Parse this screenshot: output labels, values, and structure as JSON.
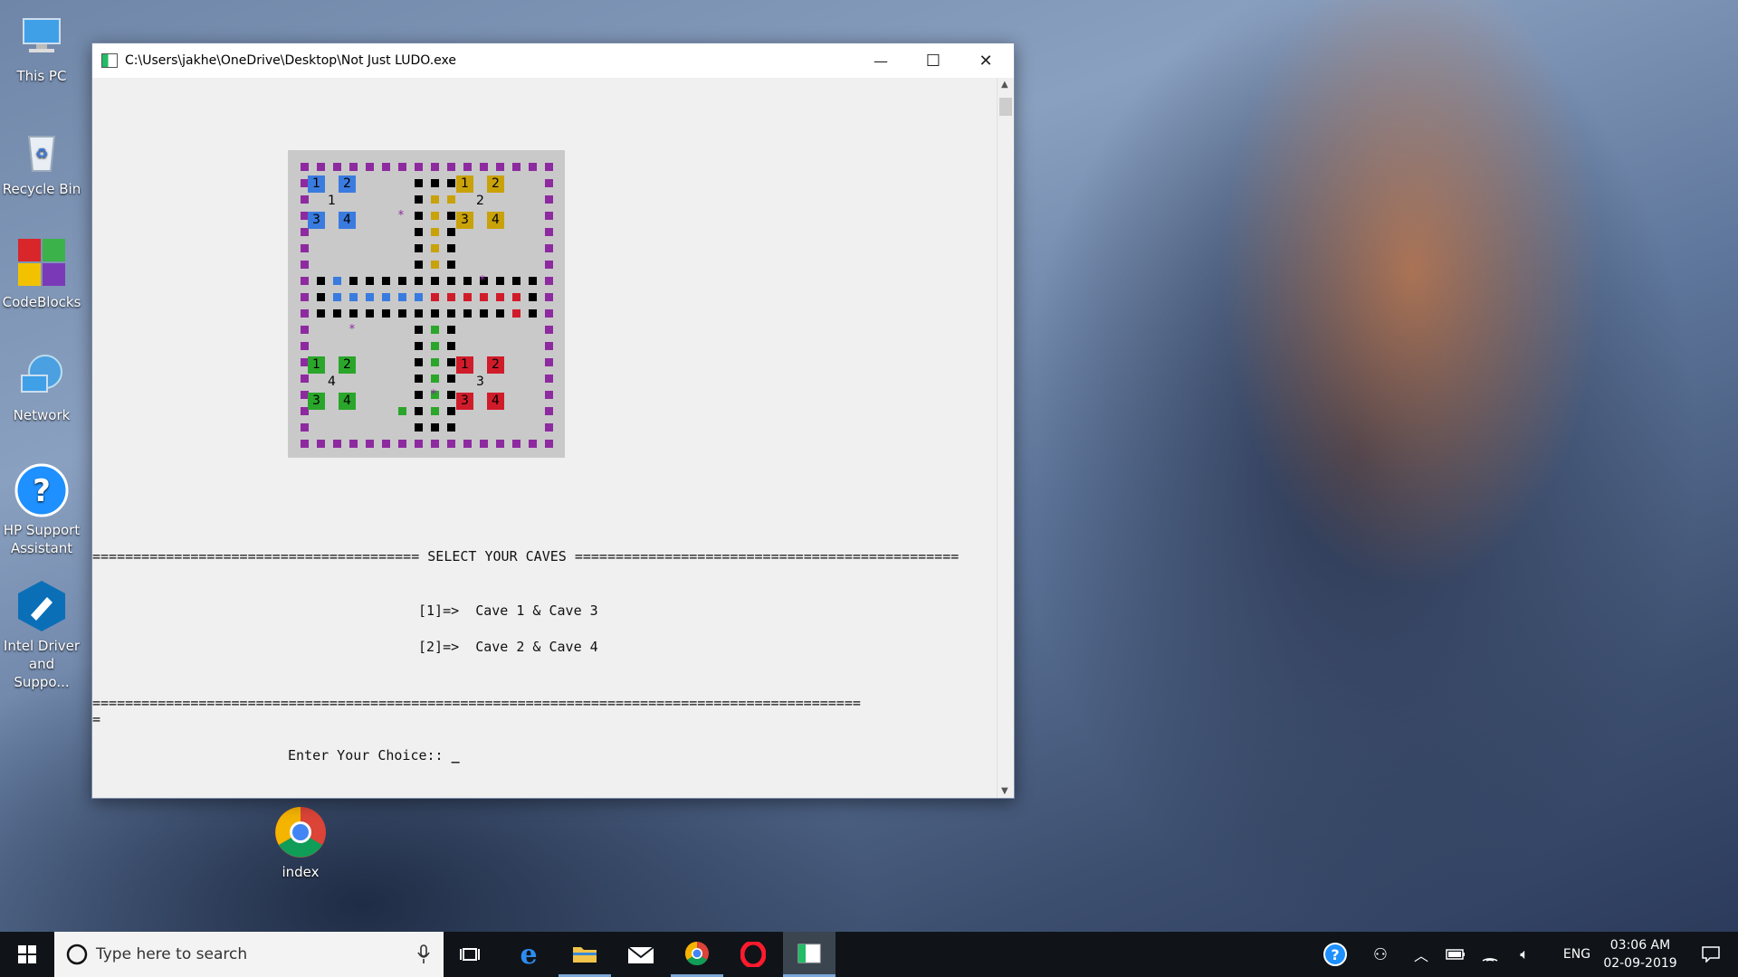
{
  "desktop": {
    "icons": [
      {
        "label": "This PC",
        "icon": "this-pc-icon"
      },
      {
        "label": "Recycle Bin",
        "icon": "recycle-bin-icon"
      },
      {
        "label": "CodeBlocks",
        "icon": "codeblocks-icon"
      },
      {
        "label": "Network",
        "icon": "network-icon"
      },
      {
        "label": "HP Support Assistant",
        "icon": "hp-support-icon"
      },
      {
        "label": "Intel Driver and Suppo...",
        "icon": "intel-driver-icon"
      },
      {
        "label": "index",
        "icon": "chrome-icon"
      }
    ]
  },
  "window": {
    "title": "C:\\Users\\jakhe\\OneDrive\\Desktop\\Not Just LUDO.exe",
    "minimize_glyph": "—",
    "maximize_glyph": "☐",
    "close_glyph": "✕"
  },
  "board": {
    "colors": {
      "border": "#8e2aa0",
      "track": "#000000",
      "blue": "#3a7be0",
      "yellow": "#c9a20a",
      "red": "#d01c2a",
      "green": "#2aa62a",
      "background": "#c9c9c9"
    },
    "caves": [
      {
        "number": "1",
        "color": "blue",
        "tokens": [
          "1",
          "2",
          "3",
          "4"
        ]
      },
      {
        "number": "2",
        "color": "yellow",
        "tokens": [
          "1",
          "2",
          "3",
          "4"
        ]
      },
      {
        "number": "4",
        "color": "green",
        "tokens": [
          "1",
          "2",
          "3",
          "4"
        ]
      },
      {
        "number": "3",
        "color": "red",
        "tokens": [
          "1",
          "2",
          "3",
          "4"
        ]
      }
    ],
    "safe_marker": "*"
  },
  "console": {
    "separator_left": "========================================",
    "heading": "SELECT YOUR CAVES",
    "separator_right": "===============================================",
    "option1": "[1]=>  Cave 1 & Cave 3",
    "option2": "[2]=>  Cave 2 & Cave 4",
    "full_separator": "==============================================================================================",
    "wrap_char": "=",
    "prompt": "Enter Your Choice::",
    "cursor": "_"
  },
  "taskbar": {
    "search_placeholder": "Type here to search",
    "language": "ENG",
    "time": "03:06 AM",
    "date": "02-09-2019"
  }
}
